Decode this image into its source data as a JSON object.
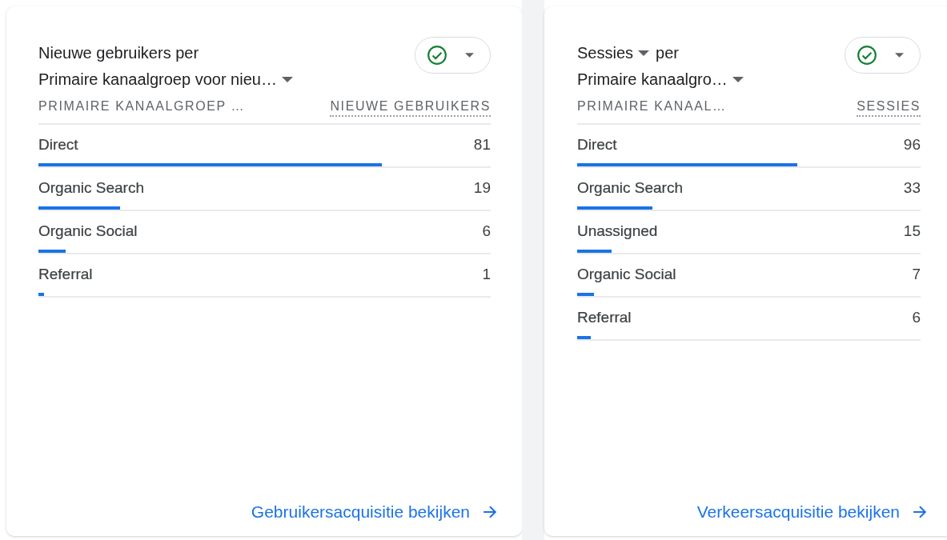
{
  "cards": [
    {
      "title_lines": [
        [
          {
            "text": "Nieuwe gebruikers per",
            "dropdown": false
          }
        ],
        [
          {
            "text": "Primaire kanaalgroep voor nieu…",
            "dropdown": true
          }
        ]
      ],
      "columns": {
        "dimension": "PRIMAIRE KANAALGROEP …",
        "metric": "NIEUWE GEBRUIKERS"
      },
      "rows": [
        {
          "label": "Direct",
          "value": "81",
          "level": 0.76
        },
        {
          "label": "Organic Search",
          "value": "19",
          "level": 0.18
        },
        {
          "label": "Organic Social",
          "value": "6",
          "level": 0.06
        },
        {
          "label": "Referral",
          "value": "1",
          "level": 0.012
        }
      ],
      "link": "Gebruikersacquisitie bekijken"
    },
    {
      "title_lines": [
        [
          {
            "text": "Sessies",
            "dropdown": true
          },
          {
            "text": "per",
            "dropdown": false
          }
        ],
        [
          {
            "text": "Primaire kanaalgro…",
            "dropdown": true
          }
        ]
      ],
      "columns": {
        "dimension": "PRIMAIRE KANAAL…",
        "metric": "SESSIES"
      },
      "rows": [
        {
          "label": "Direct",
          "value": "96",
          "level": 0.64
        },
        {
          "label": "Organic Search",
          "value": "33",
          "level": 0.22
        },
        {
          "label": "Unassigned",
          "value": "15",
          "level": 0.1
        },
        {
          "label": "Organic Social",
          "value": "7",
          "level": 0.05
        },
        {
          "label": "Referral",
          "value": "6",
          "level": 0.04
        }
      ],
      "link": "Verkeersacquisitie bekijken"
    }
  ]
}
